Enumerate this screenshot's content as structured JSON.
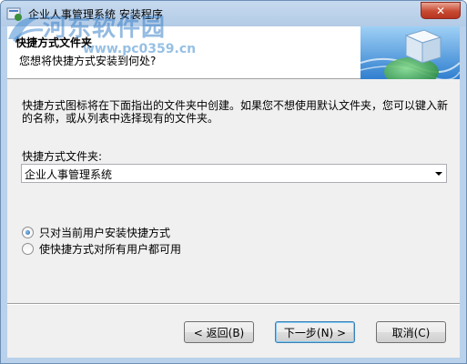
{
  "window": {
    "title": "企业人事管理系统 安装程序",
    "close_glyph": "✕"
  },
  "watermark": {
    "title": "河东软件园",
    "url": "www.pc0359.cn"
  },
  "header": {
    "title": "快捷方式文件夹",
    "subtitle": "您想将快捷方式安装到何处?"
  },
  "body": {
    "description": "快捷方式图标将在下面指出的文件夹中创建。如果您不想使用默认文件夹，您可以键入新的名称，或从列表中选择现有的文件夹。",
    "folder_label": "快捷方式文件夹:",
    "folder_value": "企业人事管理系统"
  },
  "options": [
    {
      "label": "只对当前用户安装快捷方式",
      "checked": true
    },
    {
      "label": "使快捷方式对所有用户都可用",
      "checked": false
    }
  ],
  "buttons": {
    "back": "< 返回(B)",
    "next": "下一步(N) >",
    "cancel": "取消(C)"
  },
  "icons": {
    "app": "installer-app-icon",
    "header": "globe-cube-icon",
    "dropdown": "chevron-down-icon"
  }
}
